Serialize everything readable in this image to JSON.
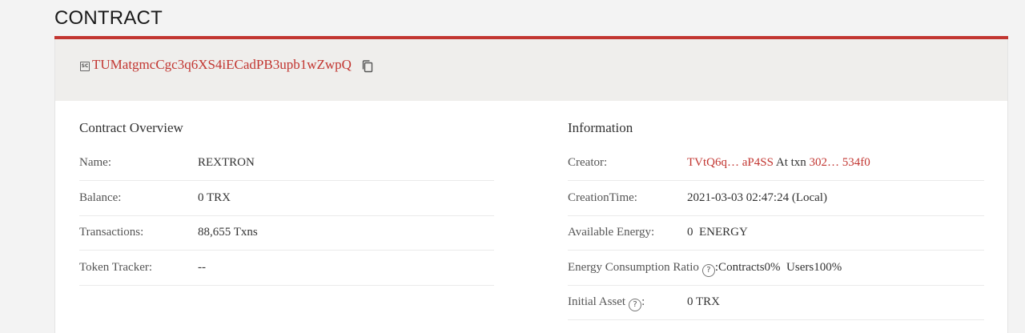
{
  "page": {
    "title": "CONTRACT"
  },
  "colors": {
    "accent": "#c23631",
    "link": "#c23631"
  },
  "address_bar": {
    "badge_icon": "smart-contract-icon",
    "badge_text": "SC",
    "address": "TUMatgmcCgc3q6XS4iECadPB3upb1wZwpQ",
    "copy_icon": "copy-icon"
  },
  "overview": {
    "title": "Contract Overview",
    "rows": [
      {
        "label": "Name:",
        "value": "REXTRON"
      },
      {
        "label": "Balance:",
        "value": "0 TRX"
      },
      {
        "label": "Transactions:",
        "value": "88,655  Txns"
      },
      {
        "label": "Token Tracker:",
        "value": "--"
      }
    ]
  },
  "information": {
    "title": "Information",
    "creator": {
      "label": "Creator:",
      "address": "TVtQ6q… aP4SS",
      "at_text": " At txn ",
      "txn": "302… 534f0"
    },
    "creation_time": {
      "label": "CreationTime:",
      "value": "2021-03-03 02:47:24 (Local)"
    },
    "available_energy": {
      "label": "Available Energy:",
      "value": "0  ENERGY"
    },
    "energy_ratio": {
      "label": "Energy Consumption Ratio",
      "help_icon": "help-icon",
      "help_glyph": "?",
      "value": ":Contracts0%  Users100%"
    },
    "initial_asset": {
      "label": "Initial Asset",
      "help_icon": "help-icon",
      "help_glyph": "?",
      "colon": ":",
      "value": "0 TRX"
    }
  }
}
